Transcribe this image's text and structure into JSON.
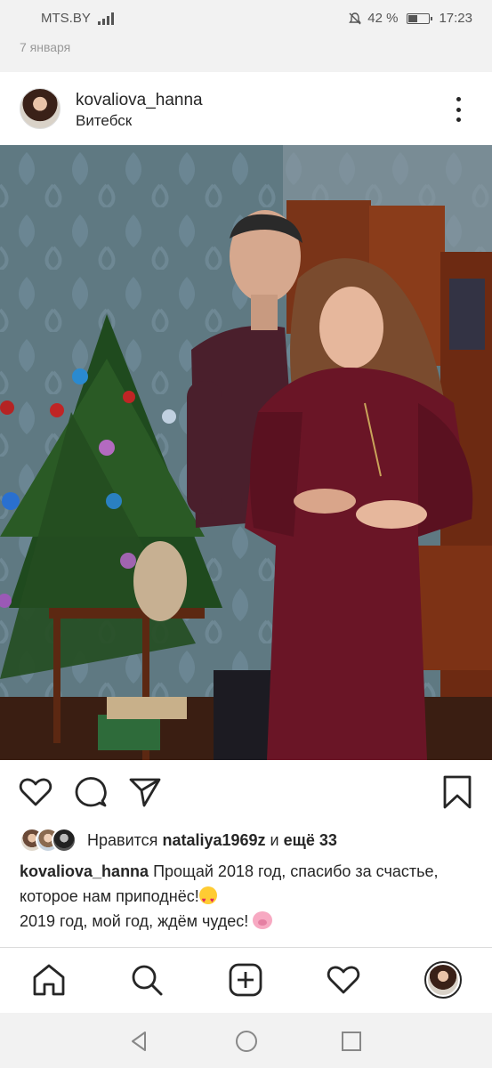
{
  "status_bar": {
    "carrier": "MTS.BY",
    "battery_percent": "42 %",
    "time": "17:23"
  },
  "post": {
    "date_label": "7 января",
    "username": "kovaliova_hanna",
    "location": "Витебск",
    "likes": {
      "prefix": "Нравится",
      "user": "nataliya1969z",
      "connector": "и",
      "more": "ещё 33"
    },
    "caption": {
      "username": "kovaliova_hanna",
      "line1": "Прощай 2018 год, спасибо за счастье, которое нам приподнёс!",
      "line2": "2019 год, мой год, ждём чудес!"
    }
  },
  "icons": {
    "header": "more-options-icon",
    "actions": [
      "heart-icon",
      "comment-icon",
      "share-icon",
      "bookmark-icon"
    ],
    "nav": [
      "home-icon",
      "search-icon",
      "add-post-icon",
      "activity-heart-icon",
      "profile-avatar"
    ],
    "system": [
      "back-icon",
      "home-circle-icon",
      "recents-icon"
    ]
  },
  "colors": {
    "background": "#ffffff",
    "text": "#262626",
    "system_bar": "#f2f2f2",
    "muted": "#999999"
  }
}
